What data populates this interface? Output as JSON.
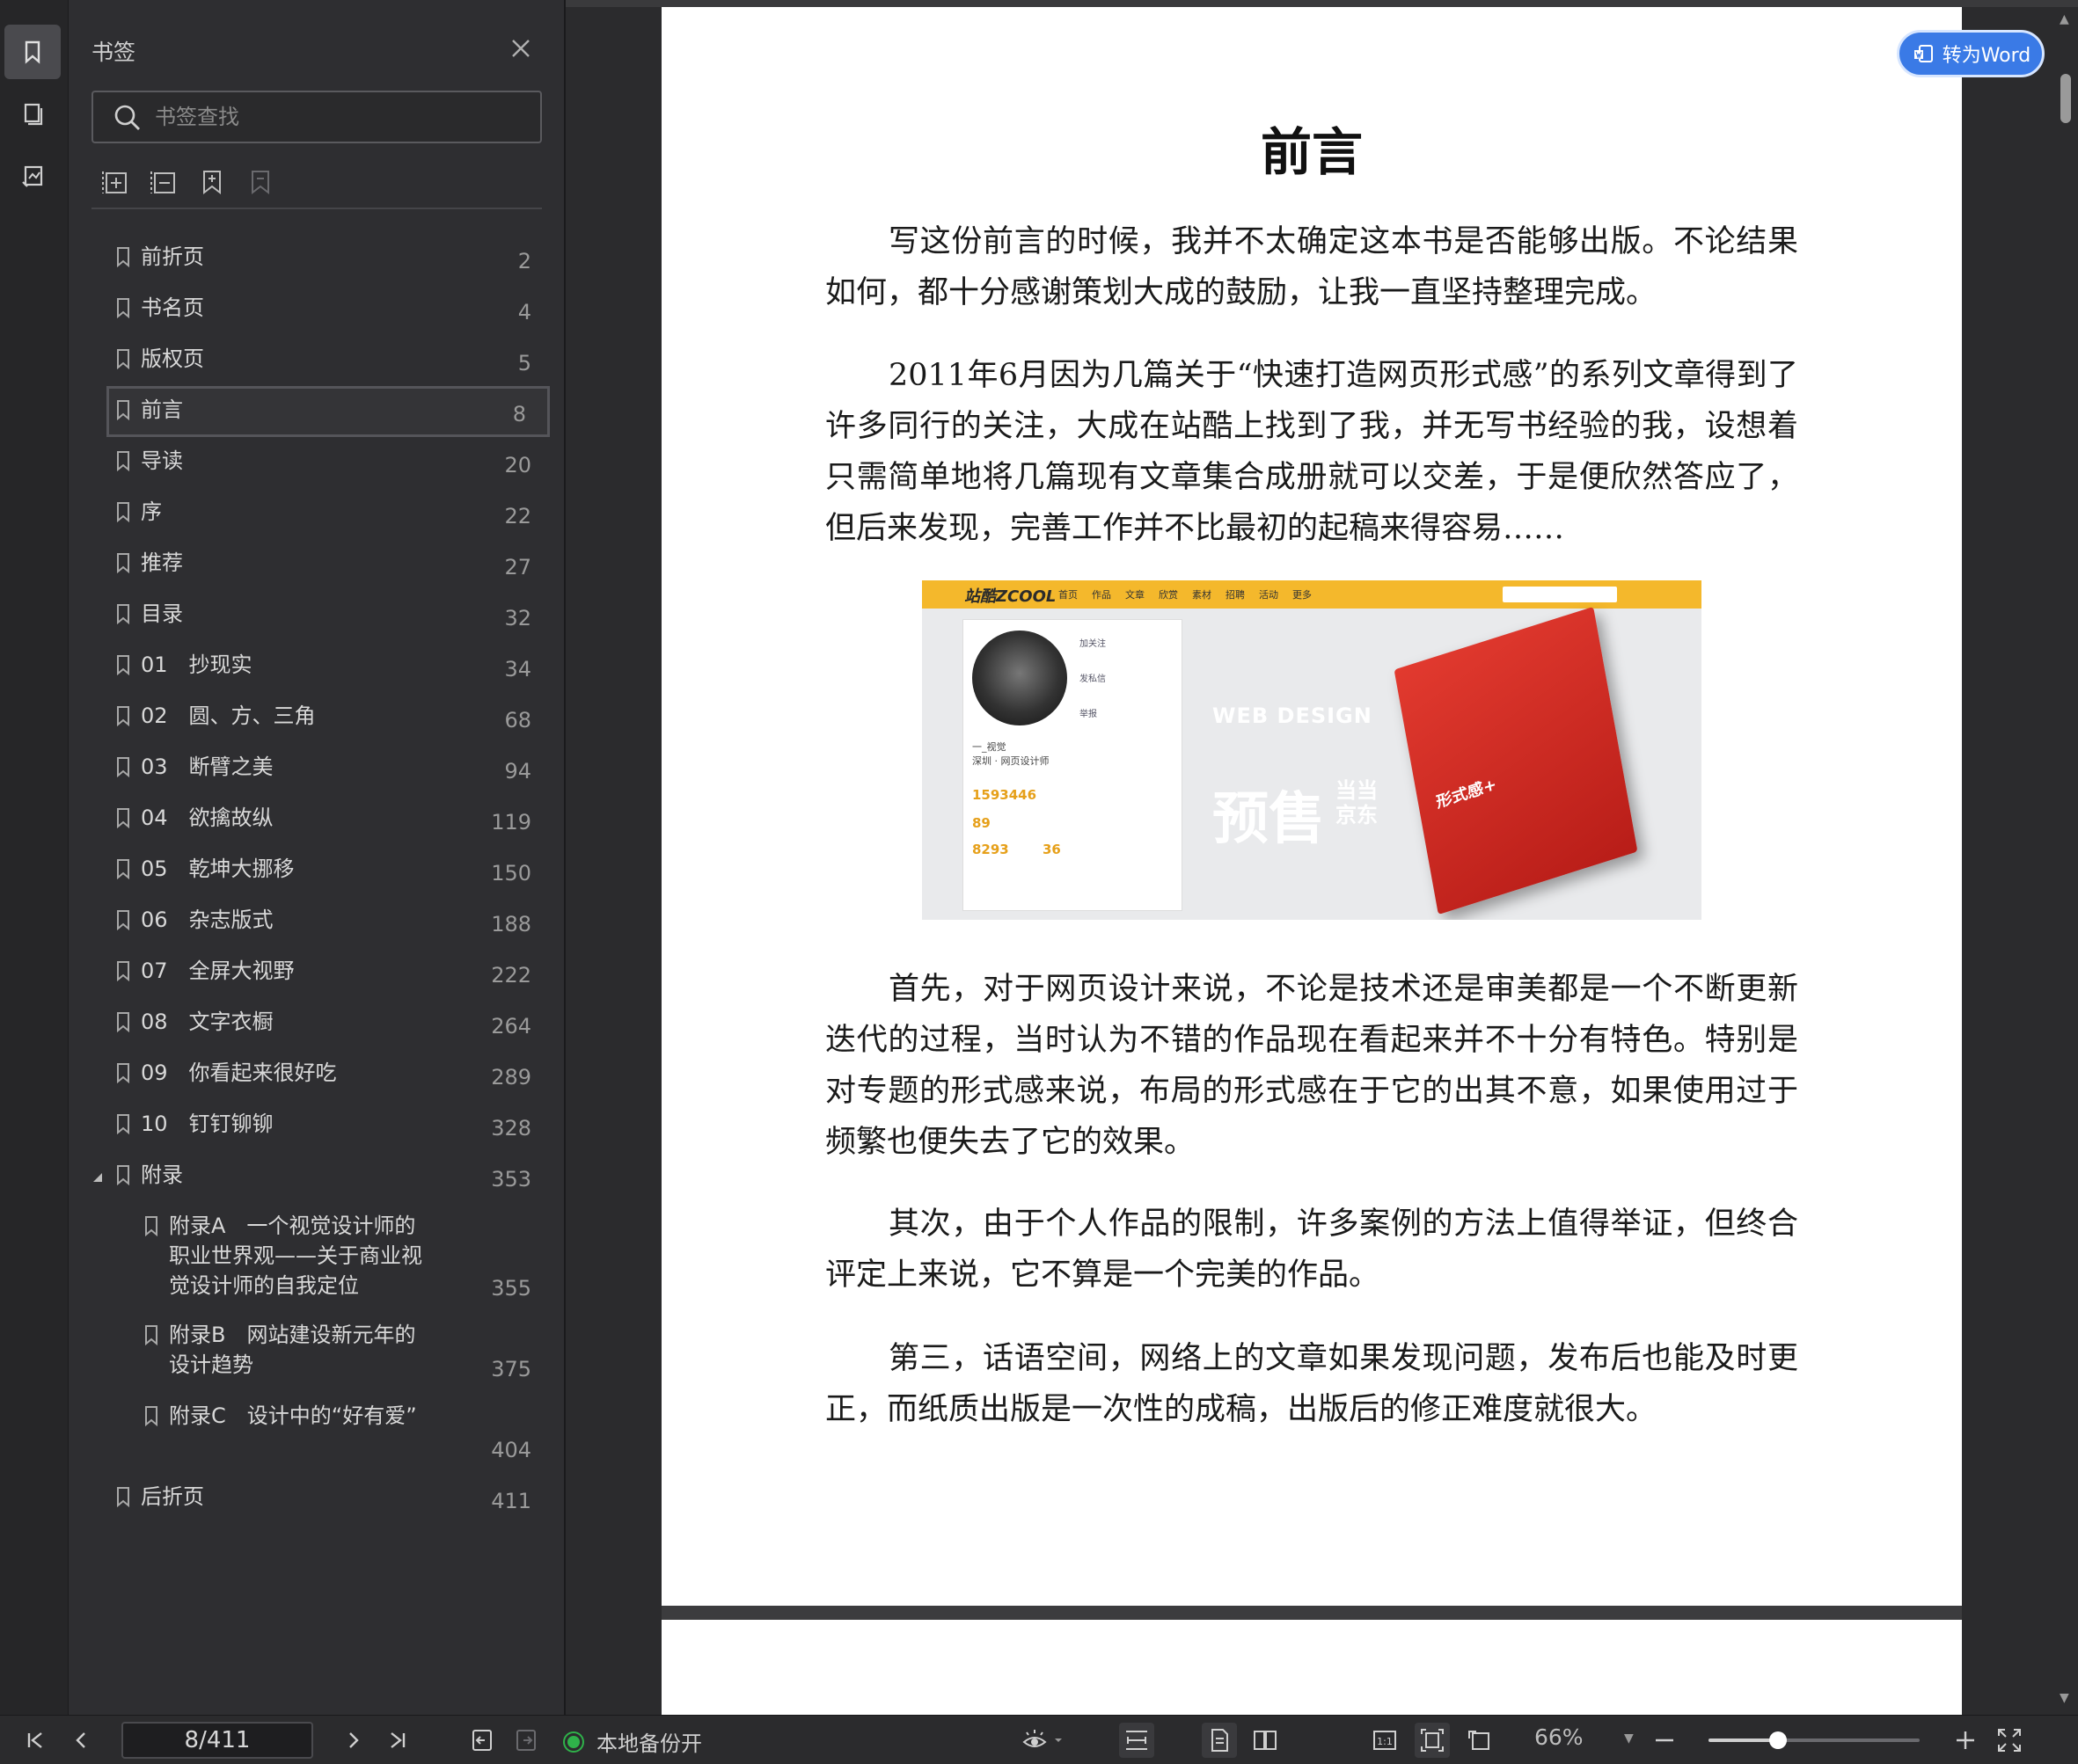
{
  "rail": {
    "items": [
      {
        "icon": "bookmark-icon",
        "active": true
      },
      {
        "icon": "pages-thumbnail-icon",
        "active": false
      },
      {
        "icon": "annotation-icon",
        "active": false
      }
    ]
  },
  "panel": {
    "title": "书签",
    "search_placeholder": "书签查找",
    "tools": [
      "expand-all-icon",
      "collapse-all-icon",
      "add-bookmark-icon",
      "remove-bookmark-icon"
    ],
    "bookmarks": [
      {
        "label": "前折页",
        "page": "2"
      },
      {
        "label": "书名页",
        "page": "4"
      },
      {
        "label": "版权页",
        "page": "5"
      },
      {
        "label": "前言",
        "page": "8",
        "selected": true
      },
      {
        "label": "导读",
        "page": "20"
      },
      {
        "label": "序",
        "page": "22"
      },
      {
        "label": "推荐",
        "page": "27"
      },
      {
        "label": "目录",
        "page": "32"
      },
      {
        "label": "01　抄现实",
        "page": "34"
      },
      {
        "label": "02　圆、方、三角",
        "page": "68"
      },
      {
        "label": "03　断臂之美",
        "page": "94"
      },
      {
        "label": "04　欲擒故纵",
        "page": "119"
      },
      {
        "label": "05　乾坤大挪移",
        "page": "150"
      },
      {
        "label": "06　杂志版式",
        "page": "188"
      },
      {
        "label": "07　全屏大视野",
        "page": "222"
      },
      {
        "label": "08　文字衣橱",
        "page": "264"
      },
      {
        "label": "09　你看起来很好吃",
        "page": "289"
      },
      {
        "label": "10　钉钉铆铆",
        "page": "328"
      },
      {
        "label": "附录",
        "page": "353",
        "expanded": true
      },
      {
        "label": "附录A　一个视觉设计师的职业世界观——关于商业视觉设计师的自我定位",
        "page": "355",
        "child": true
      },
      {
        "label": "附录B　网站建设新元年的设计趋势",
        "page": "375",
        "child": true
      },
      {
        "label": "附录C　设计中的“好有爱”",
        "page": "404",
        "child": true
      },
      {
        "label": "后折页",
        "page": "411"
      }
    ]
  },
  "document": {
    "heading": "前言",
    "paragraphs": [
      "写这份前言的时候，我并不太确定这本书是否能够出版。不论结果如何，都十分感谢策划大成的鼓励，让我一直坚持整理完成。",
      "2011年6月因为几篇关于“快速打造网页形式感”的系列文章得到了许多同行的关注，大成在站酷上找到了我，并无写书经验的我，设想着只需简单地将几篇现有文章集合成册就可以交差，于是便欣然答应了，但后来发现，完善工作并不比最初的起稿来得容易……",
      "首先，对于网页设计来说，不论是技术还是审美都是一个不断更新迭代的过程，当时认为不错的作品现在看起来并不十分有特色。特别是对专题的形式感来说，布局的形式感在于它的出其不意，如果使用过于频繁也便失去了它的效果。",
      "其次，由于个人作品的限制，许多案例的方法上值得举证，但终合评定上来说，它不算是一个完美的作品。",
      "第三，话语空间，网络上的文章如果发现问题，发布后也能及时更正，而纸质出版是一次性的成稿，出版后的修正难度就很大。"
    ],
    "figure": {
      "logo": "站酷ZCOOL",
      "nav": [
        "首页",
        "作品",
        "文章",
        "欣赏",
        "素材",
        "招聘",
        "活动",
        "更多"
      ],
      "side_links": [
        "加关注",
        "发私信",
        "举报"
      ],
      "user_name": "一_视觉",
      "user_title": "深圳 · 网页设计师",
      "stat1": "1593446",
      "stat2": "89",
      "stat3": "8293",
      "stat4": "36",
      "promo_en": "WEB DESIGN",
      "promo_presale": "预售",
      "promo_shops": "当当\n京东",
      "book_title": "形式感+"
    },
    "convert_button": "转为Word"
  },
  "statusbar": {
    "page_indicator": "8/411",
    "backup_status": "本地备份开",
    "zoom": "66%",
    "zoom_level": 0.33
  }
}
